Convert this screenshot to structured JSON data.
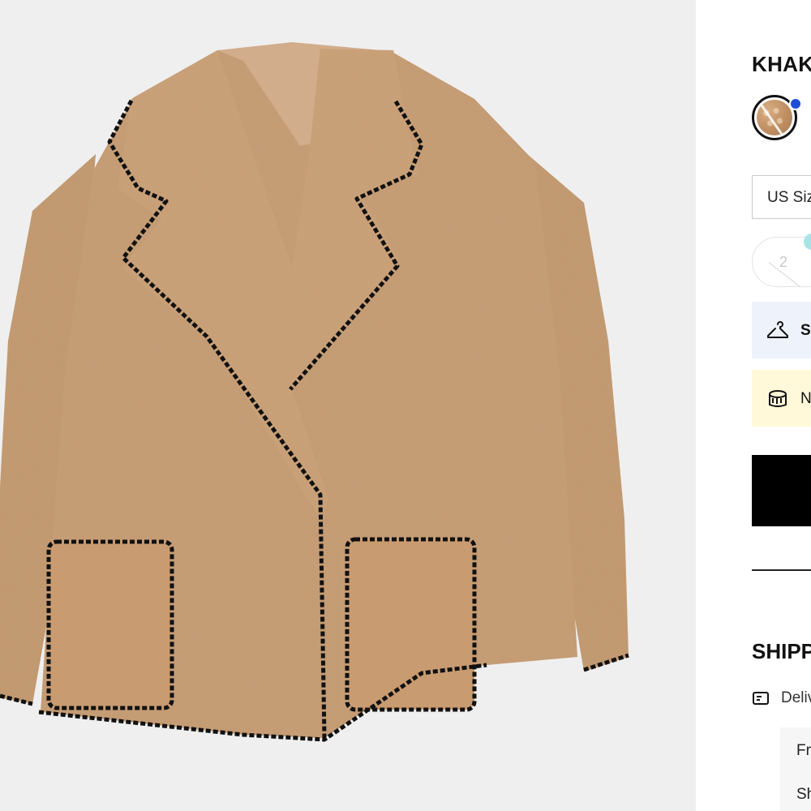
{
  "product": {
    "color_name": "KHAKI",
    "swatch_icon": "color-swatch",
    "size_select_label": "US Size",
    "size_option": "2"
  },
  "info_rows": {
    "fit_text": "S",
    "fit_icon": "hanger-icon",
    "note_text": "N",
    "note_icon": "fabric-icon"
  },
  "shipping": {
    "heading": "SHIPPING",
    "delivery_text": "Delivery",
    "delivery_icon": "delivery-icon",
    "options": [
      "Fr",
      "Sh"
    ]
  },
  "colors": {
    "gallery_bg": "#efefef",
    "coat": "#c89b72",
    "trim": "#111111",
    "fit_bg": "#eef3fb",
    "note_bg": "#fff8d9",
    "button": "#000000",
    "swatch_dot": "#1f4fd8"
  }
}
